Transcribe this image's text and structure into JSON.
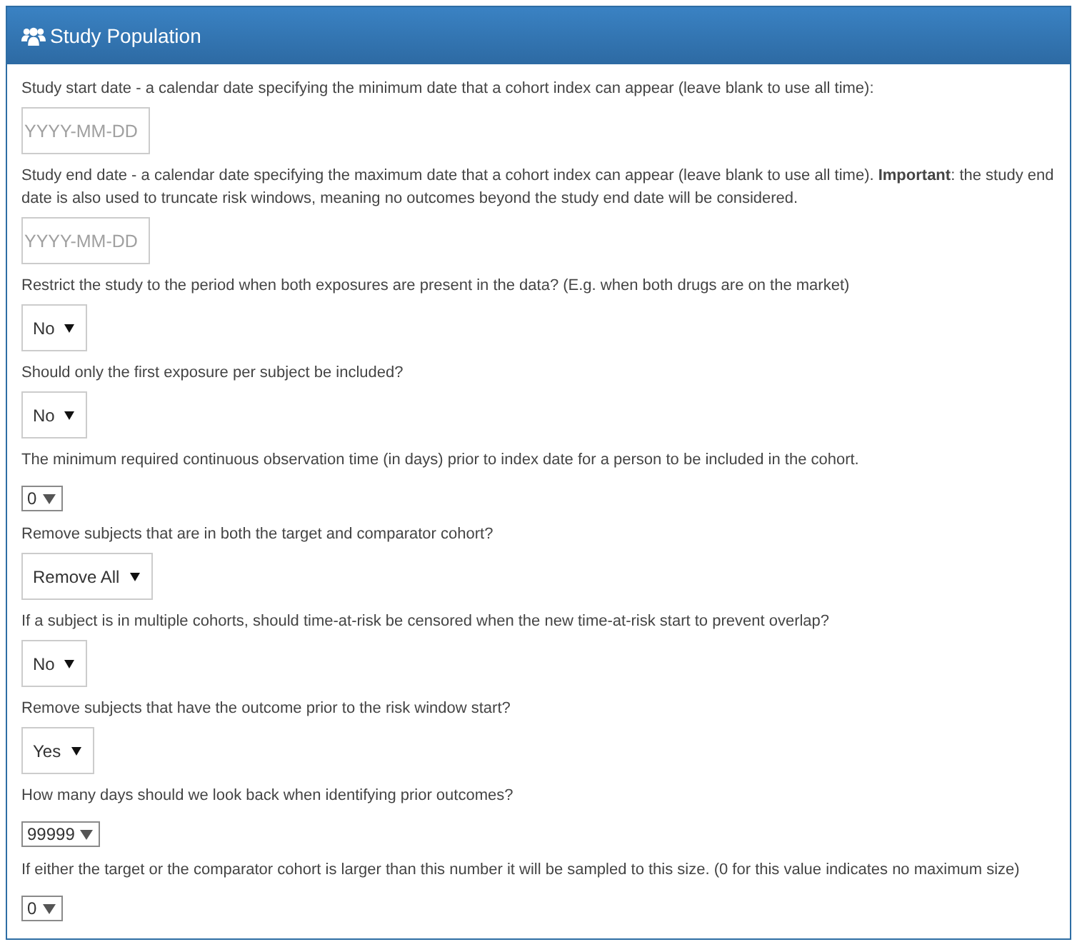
{
  "panel": {
    "title": "Study Population"
  },
  "fields": [
    {
      "kind": "date",
      "label": "Study start date - a calendar date specifying the minimum date that a cohort index can appear (leave blank to use all time):",
      "placeholder": "YYYY-MM-DD"
    },
    {
      "kind": "date",
      "label": "Study end date - a calendar date specifying the maximum date that a cohort index can appear (leave blank to use all time). **Important**: the study end date is also used to truncate risk windows, meaning no outcomes beyond the study end date will be considered.",
      "placeholder": "YYYY-MM-DD"
    },
    {
      "kind": "select",
      "label": "Restrict the study to the period when both exposures are present in the data? (E.g. when both drugs are on the market)",
      "value": "No"
    },
    {
      "kind": "select",
      "label": "Should only the first exposure per subject be included?",
      "value": "No"
    },
    {
      "kind": "compact_select",
      "label": "The minimum required continuous observation time (in days) prior to index date for a person to be included in the cohort.",
      "value": "0"
    },
    {
      "kind": "select",
      "label": "Remove subjects that are in both the target and comparator cohort?",
      "value": "Remove All"
    },
    {
      "kind": "select",
      "label": "If a subject is in multiple cohorts, should time-at-risk be censored when the new time-at-risk start to prevent overlap?",
      "value": "No"
    },
    {
      "kind": "select",
      "label": "Remove subjects that have the outcome prior to the risk window start?",
      "value": "Yes"
    },
    {
      "kind": "compact_select",
      "label": "How many days should we look back when identifying prior outcomes?",
      "value": "99999"
    },
    {
      "kind": "compact_select",
      "label": "If either the target or the comparator cohort is larger than this number it will be sampled to this size. (0 for this value indicates no maximum size)",
      "value": "0"
    }
  ]
}
